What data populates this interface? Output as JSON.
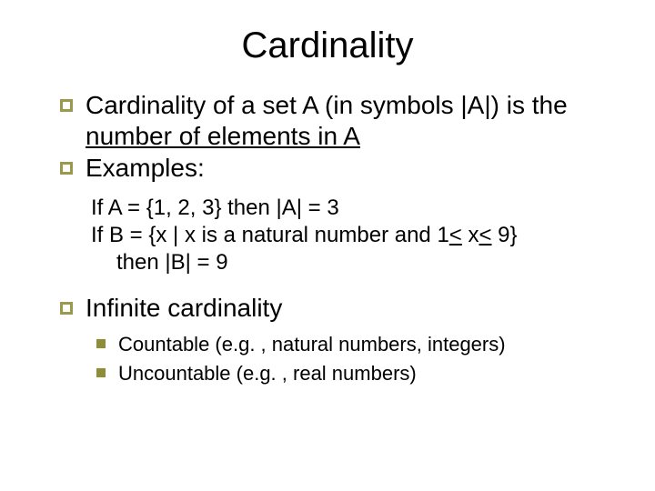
{
  "title": "Cardinality",
  "bullets1": {
    "a_prefix": "Cardinality of a set A (in symbols |A|) is the ",
    "a_underlined": "number of elements in A",
    "b": "Examples:"
  },
  "examples": {
    "line1": "If A = {1, 2, 3} then |A| = 3",
    "line2_part1": "If B = {x | x is a natural number and 1",
    "line2_le1": "<",
    "line2_mid": " x",
    "line2_le2": "<",
    "line2_part2": " 9}",
    "line3": "then |B| = 9"
  },
  "bullets2": {
    "a": "Infinite cardinality"
  },
  "sub": {
    "a": "Countable (e.g. , natural numbers, integers)",
    "b": "Uncountable (e.g. , real numbers)"
  }
}
